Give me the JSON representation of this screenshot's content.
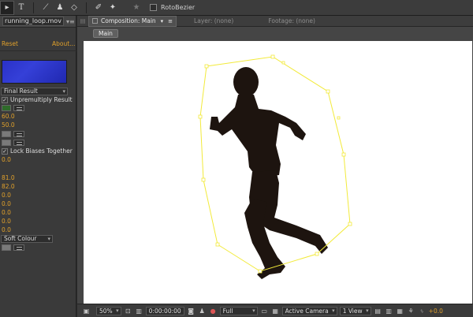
{
  "toolbar": {
    "tools": [
      {
        "icon": "selection-arrow-icon",
        "glyph": "▸"
      },
      {
        "icon": "type-tool-icon",
        "glyph": "T"
      },
      {
        "icon": "pen-tool-icon",
        "glyph": "✎"
      },
      {
        "icon": "clone-stamp-icon",
        "glyph": "♟"
      },
      {
        "icon": "eraser-icon",
        "glyph": "◇"
      },
      {
        "icon": "roto-brush-icon",
        "glyph": "✐"
      },
      {
        "icon": "puppet-pin-icon",
        "glyph": "✦"
      },
      {
        "icon": "star-icon",
        "glyph": "★"
      }
    ],
    "rotobezier_label": "RotoBezier"
  },
  "effects_panel": {
    "layer_tab": "running_loop.mov",
    "reset_label": "Reset",
    "about_label": "About...",
    "view_dropdown": "Final Result",
    "unpremultiply_label": "Unpremultiply Result",
    "value_1": "60.0",
    "value_2": "50.0",
    "lock_biases_label": "Lock Biases Together",
    "value_3": "0.0",
    "value_4": "81.0",
    "value_5": "82.0",
    "value_6": "0.0",
    "value_7": "0.0",
    "value_8": "0.0",
    "value_9": "0.0",
    "value_10": "0.0",
    "mode_dropdown": "Soft Colour",
    "swatch_color": "#2c35cc"
  },
  "composition": {
    "tab_label": "Composition: Main",
    "layer_tab": "Layer: (none)",
    "footage_tab": "Footage: (none)",
    "breadcrumb": "Main",
    "mask_color": "#f2ea3a"
  },
  "bottom_bar": {
    "zoom": "50%",
    "timecode": "0:00:00:00",
    "resolution": "Full",
    "camera": "Active Camera",
    "views": "1 View",
    "exposure": "+0.0"
  }
}
